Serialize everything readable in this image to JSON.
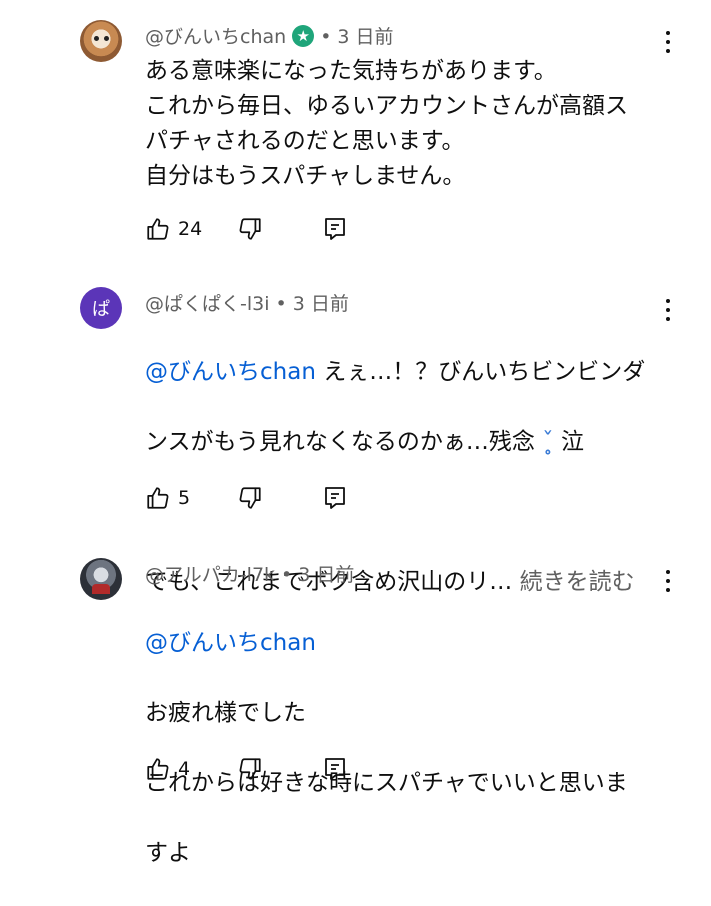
{
  "comments": [
    {
      "author": "@びんいちchan",
      "verified_icon": "star-check-icon",
      "time": "• 3 日前",
      "lines": [
        "ある意味楽になった気持ちがあります。",
        "これから毎日、ゆるいアカウントさんが高額ス",
        "パチャされるのだと思います。",
        "自分はもうスパチャしません。"
      ],
      "likes": "24"
    },
    {
      "author": "@ぱくぱく-l3i",
      "avatar_letter": "ぱ",
      "avatar_color": "#5b35b8",
      "time": "• 3 日前",
      "mention": "@びんいちchan",
      "line1_rest": " えぇ…！？びんいちビンビンダ",
      "line2_start": "ンスがもう見れなくなるのかぁ…残念 ",
      "tear_emoji": "ˇ̥̥ ",
      "line2_end": "泣",
      "line3": "でも、これまでボク含め沢山のリ…",
      "read_more": "続きを読む",
      "likes": "5"
    },
    {
      "author": "@アルパカ-l7k",
      "time": "• 3 日前",
      "mention": "@びんいちchan",
      "lines": [
        "お疲れ様でした",
        "これからは好きな時にスパチャでいいと思いま",
        "すよ"
      ],
      "likes": "4"
    }
  ],
  "icons": {
    "like": "thumbs-up-icon",
    "dislike": "thumbs-down-icon",
    "reply": "reply-icon",
    "menu": "more-vert-icon"
  }
}
